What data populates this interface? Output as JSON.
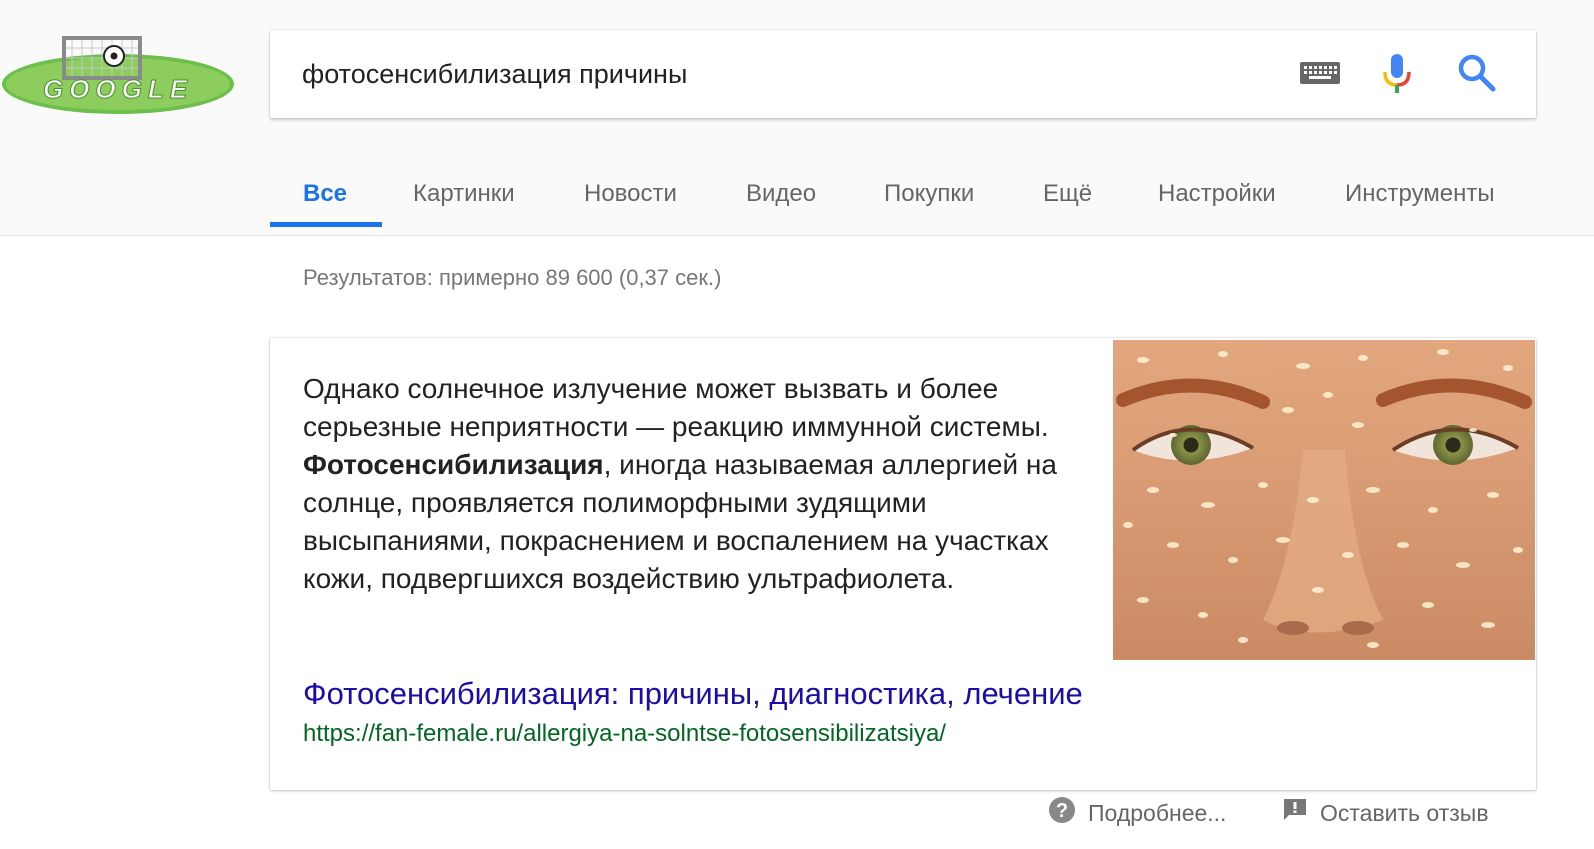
{
  "logo": {
    "text": "GOOGLE",
    "colors": {
      "field": "#6dbf4b",
      "goal": "#888888"
    }
  },
  "search": {
    "query": "фотосенсибилизация причины",
    "keyboard_icon": "keyboard-icon",
    "mic_icon": "microphone-icon",
    "search_icon": "magnifier-icon"
  },
  "tabs": [
    {
      "label": "Все",
      "active": true
    },
    {
      "label": "Картинки",
      "active": false
    },
    {
      "label": "Новости",
      "active": false
    },
    {
      "label": "Видео",
      "active": false
    },
    {
      "label": "Покупки",
      "active": false
    },
    {
      "label": "Ещё",
      "active": false
    },
    {
      "label": "Настройки",
      "active": false
    },
    {
      "label": "Инструменты",
      "active": false
    }
  ],
  "result_stats": "Результатов: примерно 89 600 (0,37 сек.)",
  "snippet": {
    "text_before": "Однако солнечное излучение может вызвать и более серьезные неприятности — реакцию иммунной системы. ",
    "text_bold": "Фотосенсибилизация",
    "text_after": ", иногда называемая аллергией на солнце, проявляется полиморфными зудящими высыпаниями, покраснением и воспалением на участках кожи, подвергшихся воздействию ультрафиолета.",
    "image_subject": "face-with-sun-spots",
    "title": "Фотосенсибилизация: причины, диагностика, лечение",
    "url": "https://fan-female.ru/allergiya-na-solntse-fotosensibilizatsiya/"
  },
  "footer": {
    "more_label": "Подробнее...",
    "more_icon": "help-circle-icon",
    "feedback_label": "Оставить отзыв",
    "feedback_icon": "feedback-icon"
  },
  "colors": {
    "accent": "#1a73e8",
    "link": "#1a0dab",
    "url": "#006621"
  }
}
